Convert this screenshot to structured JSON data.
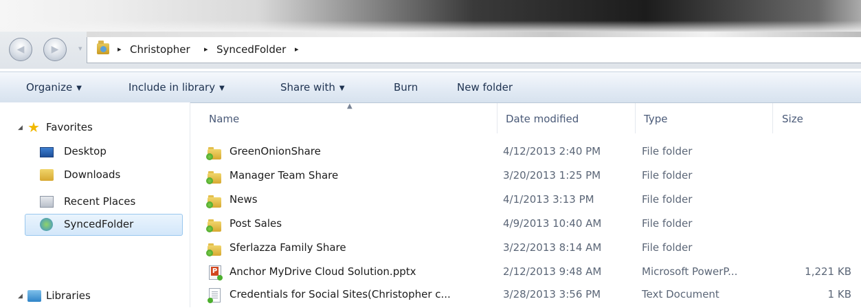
{
  "address_bar": {
    "crumbs": [
      "Christopher",
      "SyncedFolder"
    ],
    "separator": "▸"
  },
  "command_bar": {
    "organize": "Organize",
    "include_in_library": "Include in library",
    "share_with": "Share with",
    "burn": "Burn",
    "new_folder": "New folder"
  },
  "nav_pane": {
    "favorites": "Favorites",
    "items": [
      {
        "label": "Desktop",
        "icon": "desktop-icon"
      },
      {
        "label": "Downloads",
        "icon": "downloads-folder-icon"
      },
      {
        "label": "Recent Places",
        "icon": "recent-places-icon"
      },
      {
        "label": "SyncedFolder",
        "icon": "sync-folder-icon",
        "selected": true
      }
    ],
    "libraries": "Libraries"
  },
  "columns": {
    "name": "Name",
    "date_modified": "Date modified",
    "type": "Type",
    "size": "Size"
  },
  "files": [
    {
      "name": "GreenOnionShare",
      "date": "4/12/2013 2:40 PM",
      "type": "File folder",
      "size": "",
      "icon": "shared-folder-icon"
    },
    {
      "name": "Manager Team Share",
      "date": "3/20/2013 1:25 PM",
      "type": "File folder",
      "size": "",
      "icon": "shared-folder-icon"
    },
    {
      "name": "News",
      "date": "4/1/2013 3:13 PM",
      "type": "File folder",
      "size": "",
      "icon": "shared-folder-icon"
    },
    {
      "name": "Post Sales",
      "date": "4/9/2013 10:40 AM",
      "type": "File folder",
      "size": "",
      "icon": "shared-folder-icon"
    },
    {
      "name": "Sferlazza Family Share",
      "date": "3/22/2013 8:14 AM",
      "type": "File folder",
      "size": "",
      "icon": "shared-folder-icon"
    },
    {
      "name": "Anchor MyDrive Cloud Solution.pptx",
      "date": "2/12/2013 9:48 AM",
      "type": "Microsoft PowerP...",
      "size": "1,221 KB",
      "icon": "powerpoint-file-icon"
    },
    {
      "name": "Credentials for Social Sites(Christopher c...",
      "date": "3/28/2013 3:56 PM",
      "type": "Text Document",
      "size": "1 KB",
      "icon": "text-file-icon"
    }
  ],
  "colors": {
    "selection_bg": "#d3e7fa",
    "selection_border": "#99c7ee",
    "command_bar_text": "#1e3250",
    "meta_text": "#5b6677"
  }
}
